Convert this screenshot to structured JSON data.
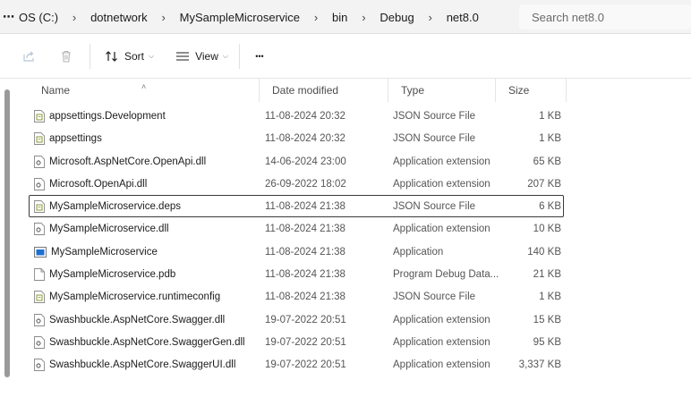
{
  "addressbar": {
    "more": "⋯",
    "crumbs": [
      "OS (C:)",
      "dotnetwork",
      "MySampleMicroservice",
      "bin",
      "Debug",
      "net8.0"
    ],
    "separator": "›",
    "search_placeholder": "Search net8.0"
  },
  "toolbar": {
    "share_icon": "share-icon",
    "delete_icon": "trash-icon",
    "sort_label": "Sort",
    "view_label": "View",
    "more_label": "•••"
  },
  "columns": {
    "name": "Name",
    "date": "Date modified",
    "type": "Type",
    "size": "Size"
  },
  "files": [
    {
      "name": "appsettings.Development",
      "date": "11-08-2024 20:32",
      "type": "JSON Source File",
      "size": "1 KB",
      "icon": "json-file-icon"
    },
    {
      "name": "appsettings",
      "date": "11-08-2024 20:32",
      "type": "JSON Source File",
      "size": "1 KB",
      "icon": "json-file-icon"
    },
    {
      "name": "Microsoft.AspNetCore.OpenApi.dll",
      "date": "14-06-2024 23:00",
      "type": "Application extension",
      "size": "65 KB",
      "icon": "dll-file-icon"
    },
    {
      "name": "Microsoft.OpenApi.dll",
      "date": "26-09-2022 18:02",
      "type": "Application extension",
      "size": "207 KB",
      "icon": "dll-file-icon"
    },
    {
      "name": "MySampleMicroservice.deps",
      "date": "11-08-2024 21:38",
      "type": "JSON Source File",
      "size": "6 KB",
      "icon": "json-file-icon",
      "focused": true
    },
    {
      "name": "MySampleMicroservice.dll",
      "date": "11-08-2024 21:38",
      "type": "Application extension",
      "size": "10 KB",
      "icon": "dll-file-icon"
    },
    {
      "name": "MySampleMicroservice",
      "date": "11-08-2024 21:38",
      "type": "Application",
      "size": "140 KB",
      "icon": "exe-file-icon"
    },
    {
      "name": "MySampleMicroservice.pdb",
      "date": "11-08-2024 21:38",
      "type": "Program Debug Data...",
      "size": "21 KB",
      "icon": "blank-file-icon"
    },
    {
      "name": "MySampleMicroservice.runtimeconfig",
      "date": "11-08-2024 21:38",
      "type": "JSON Source File",
      "size": "1 KB",
      "icon": "json-file-icon"
    },
    {
      "name": "Swashbuckle.AspNetCore.Swagger.dll",
      "date": "19-07-2022 20:51",
      "type": "Application extension",
      "size": "15 KB",
      "icon": "dll-file-icon"
    },
    {
      "name": "Swashbuckle.AspNetCore.SwaggerGen.dll",
      "date": "19-07-2022 20:51",
      "type": "Application extension",
      "size": "95 KB",
      "icon": "dll-file-icon"
    },
    {
      "name": "Swashbuckle.AspNetCore.SwaggerUI.dll",
      "date": "19-07-2022 20:51",
      "type": "Application extension",
      "size": "3,337 KB",
      "icon": "dll-file-icon"
    }
  ],
  "colors": {
    "json_icon": "#8a9a3a",
    "exe_icon": "#1f6fd1",
    "focus_border": "#3a3a3a"
  }
}
